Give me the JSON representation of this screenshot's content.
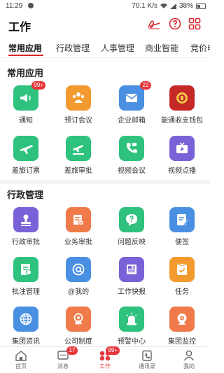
{
  "status_bar": {
    "time": "11:29",
    "network_speed": "70.1 K/s",
    "battery": "38%"
  },
  "header": {
    "title": "工作"
  },
  "tabs": [
    {
      "label": "常用应用"
    },
    {
      "label": "行政管理"
    },
    {
      "label": "人事管理"
    },
    {
      "label": "商业智能"
    },
    {
      "label": "竞价申"
    }
  ],
  "sections": [
    {
      "title": "常用应用",
      "apps": [
        {
          "label": "通知",
          "icon": "megaphone-icon",
          "color": "#2ec27e",
          "badge": "99+"
        },
        {
          "label": "预订会议",
          "icon": "people-icon",
          "color": "#f29a2e",
          "badge": ""
        },
        {
          "label": "企业邮箱",
          "icon": "mail-icon",
          "color": "#4a90e2",
          "badge": "22"
        },
        {
          "label": "能通收支钱包",
          "icon": "wallet-logo-icon",
          "color": "#c62828",
          "badge": ""
        },
        {
          "label": "差旅订票",
          "icon": "plane-icon",
          "color": "#2ec27e",
          "badge": ""
        },
        {
          "label": "差旅审批",
          "icon": "plane-approve-icon",
          "color": "#2ec27e",
          "badge": ""
        },
        {
          "label": "视频会议",
          "icon": "phone-video-icon",
          "color": "#2ec27e",
          "badge": ""
        },
        {
          "label": "视频点播",
          "icon": "tv-play-icon",
          "color": "#7b61d8",
          "badge": ""
        }
      ]
    },
    {
      "title": "行政管理",
      "apps": [
        {
          "label": "行政审批",
          "icon": "stamp-icon",
          "color": "#7b61d8",
          "badge": ""
        },
        {
          "label": "业务审批",
          "icon": "approve-doc-icon",
          "color": "#f07a4a",
          "badge": ""
        },
        {
          "label": "问题反映",
          "icon": "question-icon",
          "color": "#2ec27e",
          "badge": ""
        },
        {
          "label": "便签",
          "icon": "note-icon",
          "color": "#4a90e2",
          "badge": ""
        },
        {
          "label": "批注管理",
          "icon": "annotate-icon",
          "color": "#2ec27e",
          "badge": ""
        },
        {
          "label": "@我的",
          "icon": "at-icon",
          "color": "#4a90e2",
          "badge": ""
        },
        {
          "label": "工作快报",
          "icon": "newspaper-icon",
          "color": "#7b61d8",
          "badge": ""
        },
        {
          "label": "任务",
          "icon": "task-icon",
          "color": "#f29a2e",
          "badge": ""
        },
        {
          "label": "集团资讯",
          "icon": "globe-icon",
          "color": "#4a90e2",
          "badge": ""
        },
        {
          "label": "公司制度",
          "icon": "medal-icon",
          "color": "#f07a4a",
          "badge": ""
        },
        {
          "label": "预警中心",
          "icon": "alarm-icon",
          "color": "#2ec27e",
          "badge": ""
        },
        {
          "label": "集团监控",
          "icon": "camera-icon",
          "color": "#f07a4a",
          "badge": ""
        }
      ]
    }
  ],
  "bottom_nav": [
    {
      "label": "首页",
      "icon": "home-icon",
      "badge": ""
    },
    {
      "label": "消息",
      "icon": "message-icon",
      "badge": "17"
    },
    {
      "label": "工作",
      "icon": "work-icon",
      "badge": "99+"
    },
    {
      "label": "通讯录",
      "icon": "contacts-icon",
      "badge": ""
    },
    {
      "label": "我的",
      "icon": "profile-icon",
      "badge": ""
    }
  ],
  "colors": {
    "accent": "#d9272e",
    "badge": "#e8363d"
  }
}
